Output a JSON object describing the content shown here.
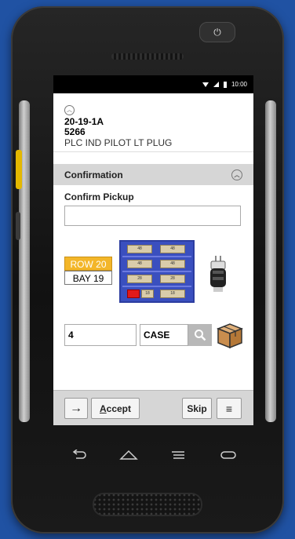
{
  "status_bar": {
    "time": "10:00"
  },
  "header": {
    "location": "20-19-1A",
    "item_number": "5266",
    "description": "PLC IND PILOT LT PLUG"
  },
  "confirmation": {
    "section_title": "Confirmation",
    "field_label": "Confirm Pickup",
    "field_value": ""
  },
  "location_visual": {
    "row_label": "ROW 20",
    "bay_label": "BAY 19",
    "rack_box_labels": [
      "48",
      "48",
      "48",
      "48",
      "28",
      "28",
      "18",
      "18",
      "18"
    ]
  },
  "quantity": {
    "value": "4",
    "unit": "CASE"
  },
  "footer": {
    "accept_first": "A",
    "accept_rest": "ccept",
    "skip_label": "Skip"
  },
  "colors": {
    "background": "#2052a3",
    "row_badge": "#f3b629",
    "section_header": "#d6d6d6",
    "rack": "#3a4fbf",
    "highlight_box": "#e11a1a"
  }
}
